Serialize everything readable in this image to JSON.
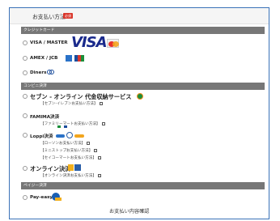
{
  "header": {
    "title": "お支払い方法",
    "required_badge": "必須"
  },
  "sections": {
    "credit": "クレジットカード",
    "convenience": "コンビニ決済",
    "payeasy": "ペイジー決済"
  },
  "credit_options": [
    {
      "label": "VISA / MASTER",
      "logo_text": "VISA"
    },
    {
      "label": "AMEX / JCB"
    },
    {
      "label": "Diners"
    }
  ],
  "convenience_options": {
    "seven": {
      "label": "セブン - オンライン 代金収納サービス",
      "link": "【セブン-イレブンお支払い方法】"
    },
    "famima": {
      "label": "FAMIMA決済",
      "link": "【ファミリーマートお支払い方法】"
    },
    "loppi": {
      "label": "Loppi決済",
      "links": [
        "【ローソンお支払い方法】",
        "【ミニストップお支払い方法】",
        "【セイコーマートお支払い方法】"
      ]
    },
    "online": {
      "label": "オンライン決済",
      "link": "【オンライン決済お支払い方法】"
    }
  },
  "payeasy_option": {
    "label": "Pay-easy"
  },
  "confirm_button": "お支払い内容確認",
  "colors": {
    "border": "#3a72b8",
    "section_bar": "#777777",
    "badge": "#d9362b",
    "visa": "#1a2a8c"
  }
}
